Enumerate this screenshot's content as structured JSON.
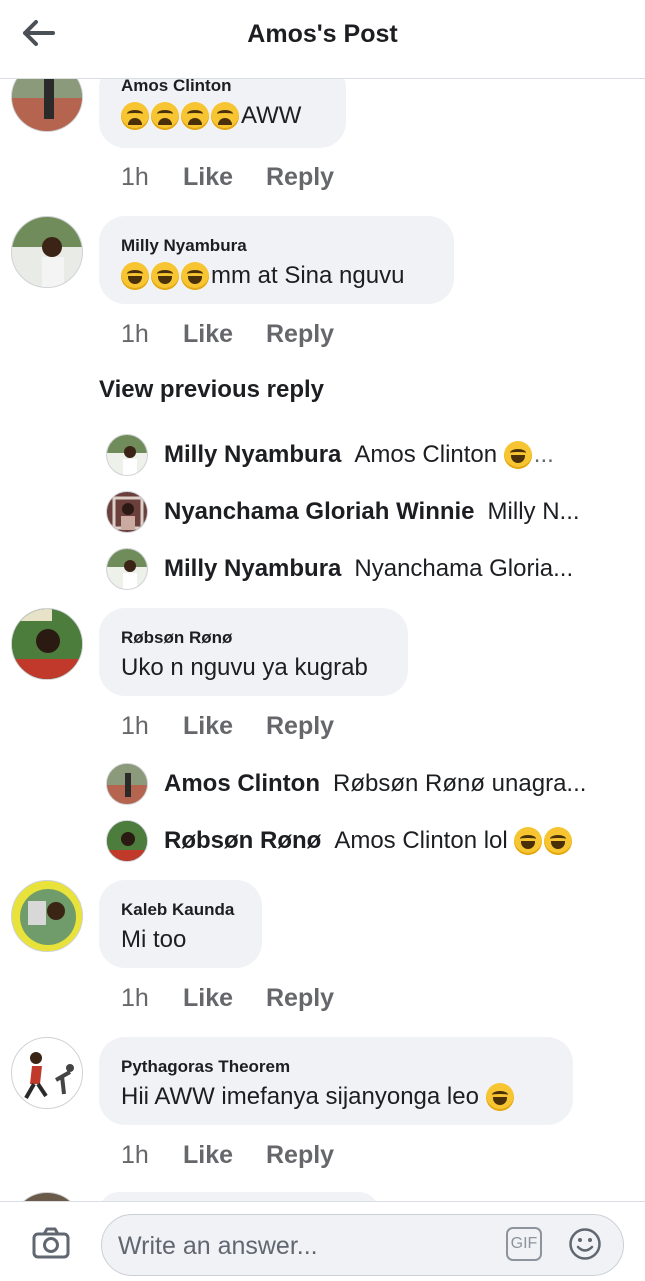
{
  "header": {
    "title": "Amos's Post"
  },
  "comments": [
    {
      "name": "Amos Clinton",
      "text": "AWW",
      "time": "1h",
      "like": "Like",
      "reply": "Reply"
    },
    {
      "name": "Milly Nyambura",
      "text": "mm at Sina nguvu",
      "time": "1h",
      "like": "Like",
      "reply": "Reply"
    },
    {
      "name": "Røbsøn Rønø",
      "text": "Uko n nguvu ya kugrab",
      "time": "1h",
      "like": "Like",
      "reply": "Reply"
    },
    {
      "name": "Kaleb Kaunda",
      "text": "Mi too",
      "time": "1h",
      "like": "Like",
      "reply": "Reply"
    },
    {
      "name": "Pythagoras Theorem",
      "text": "Hii AWW imefanya sijanyonga leo",
      "time": "1h",
      "like": "Like",
      "reply": "Reply"
    }
  ],
  "view_previous": "View previous reply",
  "replies_a": [
    {
      "name": "Milly Nyambura",
      "text": "Amos Clinton"
    },
    {
      "name": "Nyanchama Gloriah Winnie",
      "text": "Milly N..."
    },
    {
      "name": "Milly Nyambura",
      "text": "Nyanchama Gloria..."
    }
  ],
  "replies_b": [
    {
      "name": "Amos Clinton",
      "text": "Røbsøn Rønø unagra..."
    },
    {
      "name": "Røbsøn Rønø",
      "text": "Amos Clinton lol"
    }
  ],
  "composer": {
    "placeholder": "Write an answer...",
    "gif_label": "GIF"
  },
  "colors": {
    "bubble": "#f0f2f5",
    "meta": "#65676b",
    "text": "#1c1e21",
    "divider": "#dadde1"
  },
  "icons": [
    "back-arrow-icon",
    "camera-icon",
    "smiley-icon",
    "crying-laughing-emoji",
    "crying-emoji"
  ]
}
